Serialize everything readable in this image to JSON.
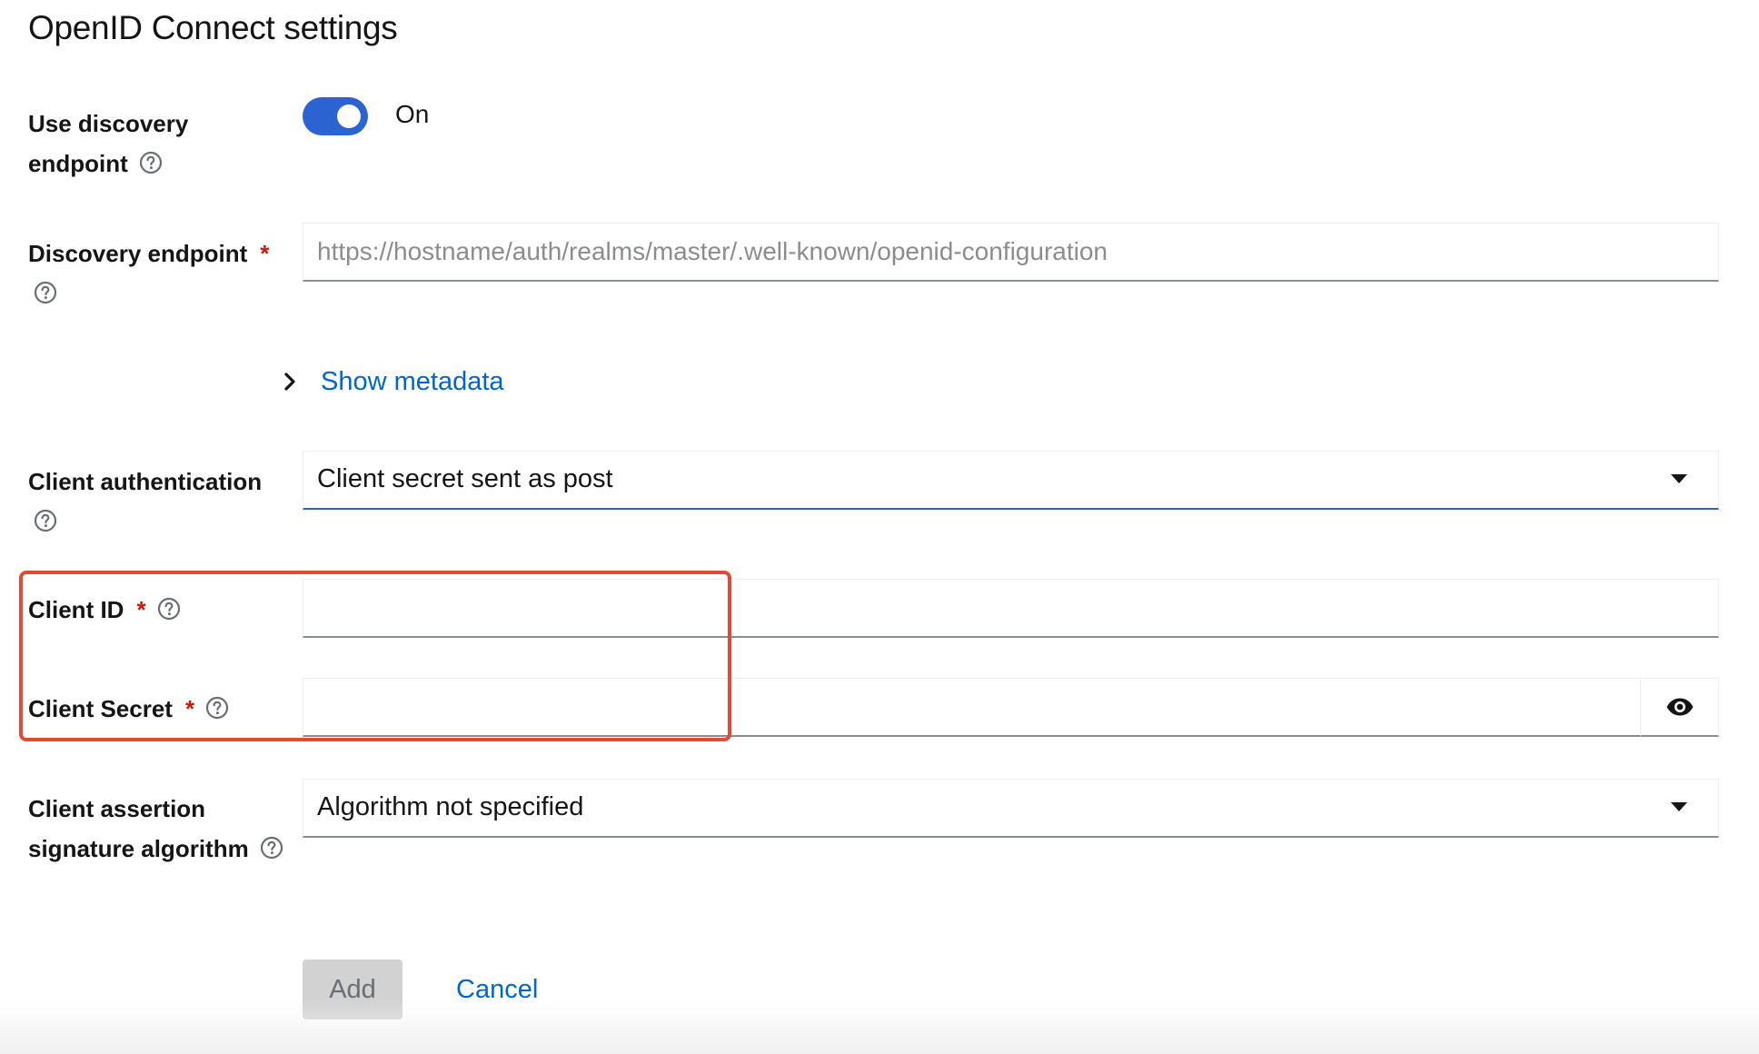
{
  "section": {
    "title": "OpenID Connect settings"
  },
  "discovery_toggle": {
    "label_line1": "Use discovery",
    "label_line2": "endpoint",
    "state_label": "On",
    "enabled": true
  },
  "discovery_endpoint": {
    "label": "Discovery endpoint",
    "required_mark": "*",
    "placeholder": "https://hostname/auth/realms/master/.well-known/openid-configuration",
    "value": ""
  },
  "metadata": {
    "toggle_label": "Show metadata"
  },
  "client_authentication": {
    "label": "Client authentication",
    "selected": "Client secret sent as post"
  },
  "client_id": {
    "label": "Client ID",
    "required_mark": "*",
    "value": ""
  },
  "client_secret": {
    "label": "Client Secret",
    "required_mark": "*",
    "value": ""
  },
  "client_assertion": {
    "label_line1": "Client assertion",
    "label_line2": "signature algorithm",
    "selected": "Algorithm not specified"
  },
  "actions": {
    "add_label": "Add",
    "cancel_label": "Cancel"
  },
  "colors": {
    "accent": "#2b63d0",
    "link": "#0066cc",
    "required": "#c9190b",
    "highlight": "#e24a36"
  },
  "icons": {
    "help": "question-circle-icon",
    "eye": "eye-icon",
    "chevron": "chevron-right-icon",
    "caret": "caret-down-icon"
  }
}
